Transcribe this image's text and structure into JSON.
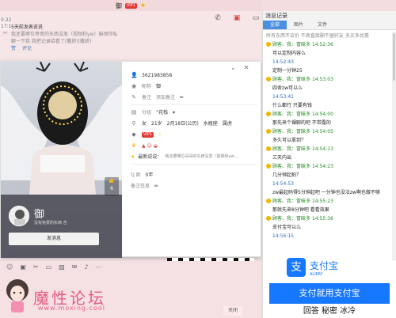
{
  "title": {
    "name": "御",
    "vip": "VIP1"
  },
  "left_times": [
    "0:22",
    "17:1"
  ],
  "feed": {
    "line1": "5天前发表说说",
    "line2": "我还要哪位哥哥的东西没发（视频和yw）麻烦你私聊一下我 我把记录给看了(撒娇)(撒娇)",
    "like": "赞",
    "comment": "评论"
  },
  "profile": {
    "likes": "6",
    "nickname": "御",
    "nick_sub": "没有免费的东西 吉 ",
    "send_button": "发消息",
    "qq": "3621983858",
    "nickname_label": "昵称",
    "nickname_value": "御",
    "remark_label": "备注",
    "remark_placeholder": "添加备注",
    "group_label": "分组",
    "group_value": "°花栈",
    "gender": "女",
    "age": "21岁",
    "birthday": "2月18日(公历)",
    "zodiac": "水瓶座",
    "animal": "属虎",
    "signature_label": "最新说说：",
    "signature": "我还要哪位哥哥的东西没发（视频和yw...",
    "qage_label": "Q 龄",
    "qage_value": "0年",
    "remark_info_label": "备注信息"
  },
  "composer_icons": [
    "emoji-icon",
    "gif-icon",
    "scissors-icon",
    "folder-icon",
    "image-icon",
    "gift-icon",
    "mic-icon",
    "more-icon"
  ],
  "watermark": {
    "title": "魔性论坛",
    "url": "www.moxing.cool"
  },
  "close_label": "关闭",
  "history": {
    "header": "消息记录",
    "tabs": [
      "全部",
      "图片",
      "文件"
    ],
    "top_line": "所有东西不议价 不卖直接删不留好友 多买多优惠",
    "items": [
      {
        "type": "meta",
        "who": "顾客、我：冒昧多",
        "time": "14:52:36"
      },
      {
        "type": "msg",
        "text": "可以定制内容么"
      },
      {
        "type": "time",
        "text": "14:52:43"
      },
      {
        "type": "msg",
        "text": "定制一分钟25"
      },
      {
        "type": "meta",
        "who": "顾客、我：冒昧多",
        "time": "14:53:03"
      },
      {
        "type": "msg",
        "text": "四舍zw可以么"
      },
      {
        "type": "time",
        "text": "14:53:41"
      },
      {
        "type": "msg",
        "text": "什么都行 只要有钱"
      },
      {
        "type": "meta",
        "who": "顾客、我：冒昧多",
        "time": "14:54:00"
      },
      {
        "type": "msg",
        "text": "那先来个裸聊的吧 不带露的"
      },
      {
        "type": "meta",
        "who": "顾客、我：冒昧多",
        "time": "14:54:05"
      },
      {
        "type": "msg",
        "text": "多久可以拿到？"
      },
      {
        "type": "meta",
        "who": "顾客、我：冒昧多",
        "time": "14:54:13"
      },
      {
        "type": "msg",
        "text": "三天内出"
      },
      {
        "type": "meta",
        "who": "顾客、我：冒昧多",
        "time": "14:54:23"
      },
      {
        "type": "msg",
        "text": "几分钟起拍？"
      },
      {
        "type": "time",
        "text": "14:54:53"
      },
      {
        "type": "msg",
        "text": "zw最起码得5分钟起吧 一分钟也没法zw啊也做不够"
      },
      {
        "type": "meta",
        "who": "顾客、我：冒昧多",
        "time": "14:55:23"
      },
      {
        "type": "msg",
        "text": "那就先来8分钟吧 看看效果"
      },
      {
        "type": "meta",
        "who": "顾客、我：冒昧多",
        "time": "14:55:36"
      },
      {
        "type": "msg",
        "text": "支付宝可以么"
      },
      {
        "type": "time",
        "text": "14:56:15"
      }
    ]
  },
  "ad": {
    "brand": "支付宝",
    "brand_en": "ALIPAY",
    "banner": "支付就用支付宝",
    "footer": "回答 秘密 冰冷"
  },
  "colors": {
    "accent": "#4a90e2",
    "vip": "#e53935",
    "watermark": "#e95a85",
    "alipay": "#1677ff"
  }
}
